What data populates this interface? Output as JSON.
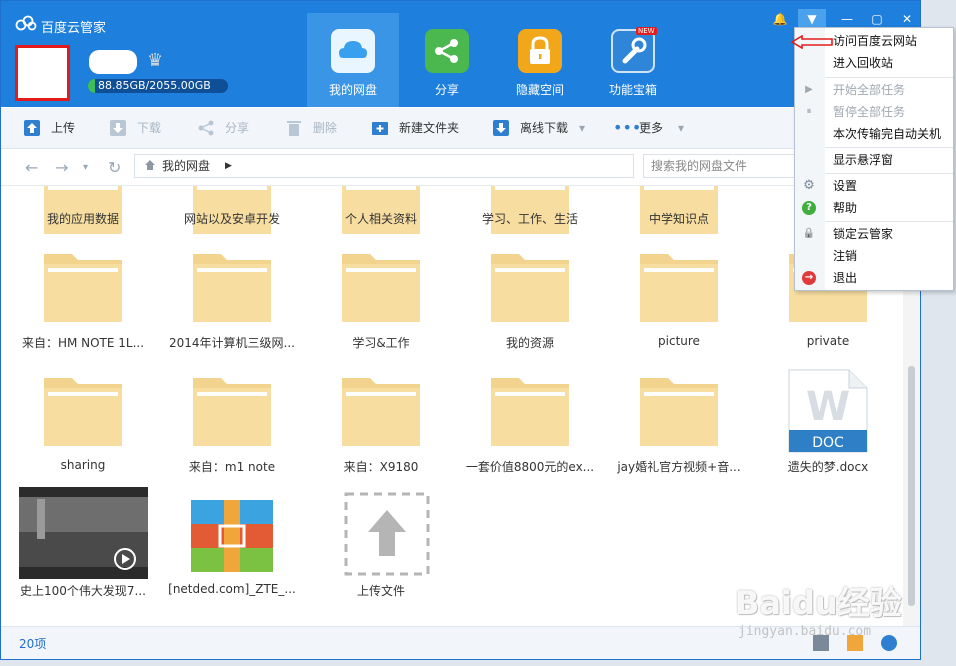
{
  "app": {
    "title": "百度云管家",
    "quota": "88.85GB/2055.00GB",
    "quota_fraction": 0.043
  },
  "nav": [
    {
      "label": "我的网盘",
      "active": true,
      "color": "#dcefff"
    },
    {
      "label": "分享",
      "active": false,
      "color": "#4bb84f"
    },
    {
      "label": "隐藏空间",
      "active": false,
      "color": "#f2a71b"
    },
    {
      "label": "功能宝箱",
      "active": false,
      "color": "#2f86d8",
      "badge": "NEW"
    }
  ],
  "toolbar": {
    "upload": "上传",
    "download": "下载",
    "share": "分享",
    "delete": "删除",
    "new_folder": "新建文件夹",
    "offline": "离线下载",
    "more": "更多"
  },
  "address": {
    "path": "我的网盘",
    "search_placeholder": "搜索我的网盘文件"
  },
  "items": [
    {
      "label": "我的应用数据",
      "type": "folder"
    },
    {
      "label": "网站以及安卓开发",
      "type": "folder"
    },
    {
      "label": "个人相关资料",
      "type": "folder"
    },
    {
      "label": "学习、工作、生活",
      "type": "folder"
    },
    {
      "label": "中学知识点",
      "type": "folder"
    },
    {
      "label": "来自：HM NOTE 1L...",
      "type": "folder"
    },
    {
      "label": "2014年计算机三级网...",
      "type": "folder"
    },
    {
      "label": "学习&工作",
      "type": "folder"
    },
    {
      "label": "我的资源",
      "type": "folder"
    },
    {
      "label": "picture",
      "type": "folder"
    },
    {
      "label": "private",
      "type": "folder"
    },
    {
      "label": "sharing",
      "type": "folder"
    },
    {
      "label": "来自：m1 note",
      "type": "folder"
    },
    {
      "label": "来自：X9180",
      "type": "folder"
    },
    {
      "label": "一套价值8800元的ex...",
      "type": "folder"
    },
    {
      "label": "jay婚礼官方视频+音...",
      "type": "folder"
    },
    {
      "label": "遗失的梦.docx",
      "type": "doc",
      "ext": "DOC"
    },
    {
      "label": "史上100个伟大发现7...",
      "type": "video"
    },
    {
      "label": "[netded.com]_ZTE_...",
      "type": "archive"
    },
    {
      "label": "上传文件",
      "type": "upload"
    }
  ],
  "status": {
    "count": "20项"
  },
  "menu": {
    "items": [
      {
        "label": "访问百度云网站",
        "disabled": false,
        "icon": ""
      },
      {
        "label": "进入回收站",
        "disabled": false,
        "icon": ""
      },
      {
        "label": "开始全部任务",
        "disabled": true,
        "icon": "▶"
      },
      {
        "label": "暂停全部任务",
        "disabled": true,
        "icon": "⏸"
      },
      {
        "label": "本次传输完自动关机",
        "disabled": false,
        "icon": ""
      },
      {
        "label": "显示悬浮窗",
        "disabled": false,
        "icon": ""
      },
      {
        "label": "设置",
        "disabled": false,
        "icon": "⚙"
      },
      {
        "label": "帮助",
        "disabled": false,
        "icon": "?"
      },
      {
        "label": "锁定云管家",
        "disabled": false,
        "icon": "🔒"
      },
      {
        "label": "注销",
        "disabled": false,
        "icon": ""
      },
      {
        "label": "退出",
        "disabled": false,
        "icon": "→"
      }
    ]
  },
  "watermark": {
    "brand": "Baidu经验",
    "url": "jingyan.baidu.com"
  }
}
